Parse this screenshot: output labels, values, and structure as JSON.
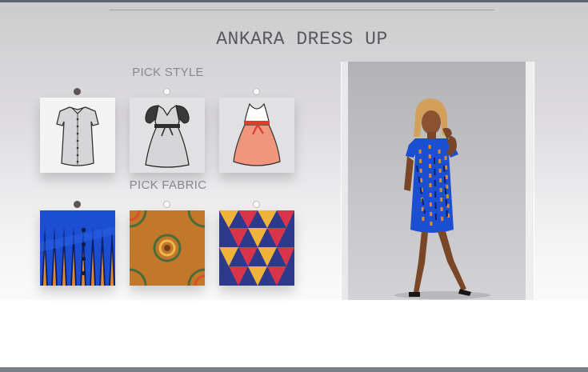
{
  "app": {
    "title": "ANKARA DRESS UP"
  },
  "sections": {
    "style": {
      "label": "PICK STYLE",
      "options": [
        {
          "name": "button-shirt-dress",
          "selected": true
        },
        {
          "name": "puff-sleeve-belted-dress",
          "selected": false
        },
        {
          "name": "sleeveless-flare-dress",
          "selected": false
        }
      ]
    },
    "fabric": {
      "label": "PICK FABRIC",
      "options": [
        {
          "name": "blue-orange-zigzag-print",
          "selected": true
        },
        {
          "name": "olive-orange-circle-print",
          "selected": false
        },
        {
          "name": "red-yellow-triangle-print",
          "selected": false
        }
      ]
    }
  },
  "preview": {
    "image": "model-wearing-selected-dress"
  },
  "colors": {
    "accent": "#5e5356",
    "title": "#55595e",
    "label": "#858990",
    "fabric_blue": "#1c4ed1",
    "fabric_orange": "#e08a2a"
  }
}
